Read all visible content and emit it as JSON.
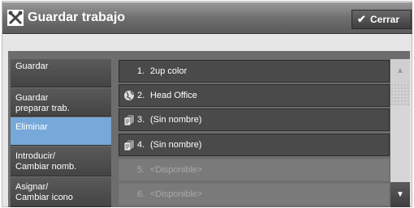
{
  "window": {
    "title": "Guardar trabajo",
    "close_label": "Cerrar"
  },
  "tabs": [
    {
      "label": "Guardar",
      "active": false
    },
    {
      "label": "Guardar\npreparar trab.",
      "active": false
    },
    {
      "label": "Eliminar",
      "active": true
    },
    {
      "label": "Introducir/\nCambiar nomb.",
      "active": false
    },
    {
      "label": "Asignar/\nCambiar icono",
      "active": false
    }
  ],
  "jobs": [
    {
      "number": "1.",
      "name": "2up color",
      "icon": "none",
      "available": false
    },
    {
      "number": "2.",
      "name": "Head Office",
      "icon": "globe-icon",
      "available": false
    },
    {
      "number": "3.",
      "name": "(Sin nombre)",
      "icon": "documents-icon",
      "available": false
    },
    {
      "number": "4.",
      "name": "(Sin nombre)",
      "icon": "documents-icon",
      "available": false
    },
    {
      "number": "5.",
      "name": "<Disponible>",
      "icon": "none",
      "available": true
    },
    {
      "number": "6.",
      "name": "<Disponible>",
      "icon": "none",
      "available": true
    }
  ],
  "colors": {
    "accent": "#76a8da",
    "titlebar": "#6f6f6f",
    "row": "#4a4a4a"
  }
}
